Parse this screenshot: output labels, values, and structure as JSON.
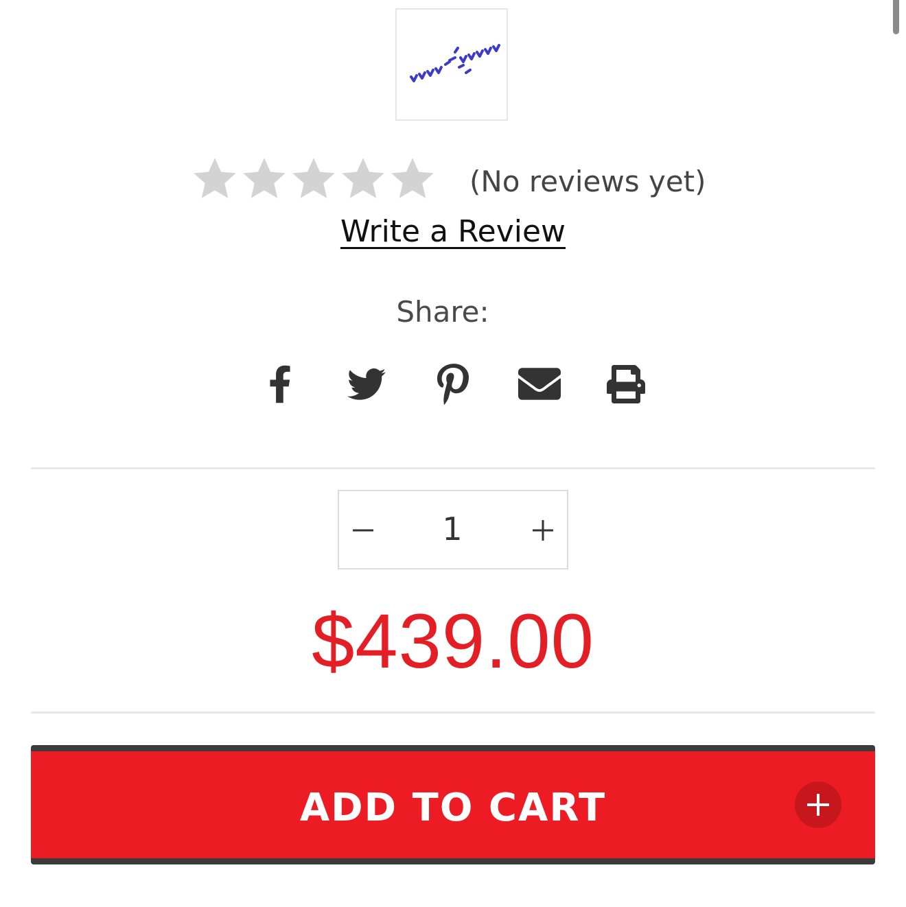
{
  "product": {
    "thumbnail_icon": "tick-marks-thumbnail"
  },
  "rating": {
    "stars_filled": 0,
    "stars_total": 5,
    "no_reviews_text": "(No reviews yet)",
    "write_review_label": "Write a Review"
  },
  "share": {
    "label": "Share:",
    "icons": [
      "facebook-icon",
      "twitter-icon",
      "pinterest-icon",
      "email-icon",
      "print-icon"
    ]
  },
  "quantity": {
    "value": "1",
    "decrement_icon": "minus-icon",
    "increment_icon": "plus-icon"
  },
  "price": {
    "display": "$439.00"
  },
  "cart": {
    "button_label": "ADD TO CART",
    "icon": "plus-circle-icon"
  },
  "colors": {
    "accent": "#ED1C24",
    "price": "#E31E24",
    "button_border": "#3B3B3B",
    "star_empty": "#D3D3D3",
    "icon_dark": "#333333"
  }
}
